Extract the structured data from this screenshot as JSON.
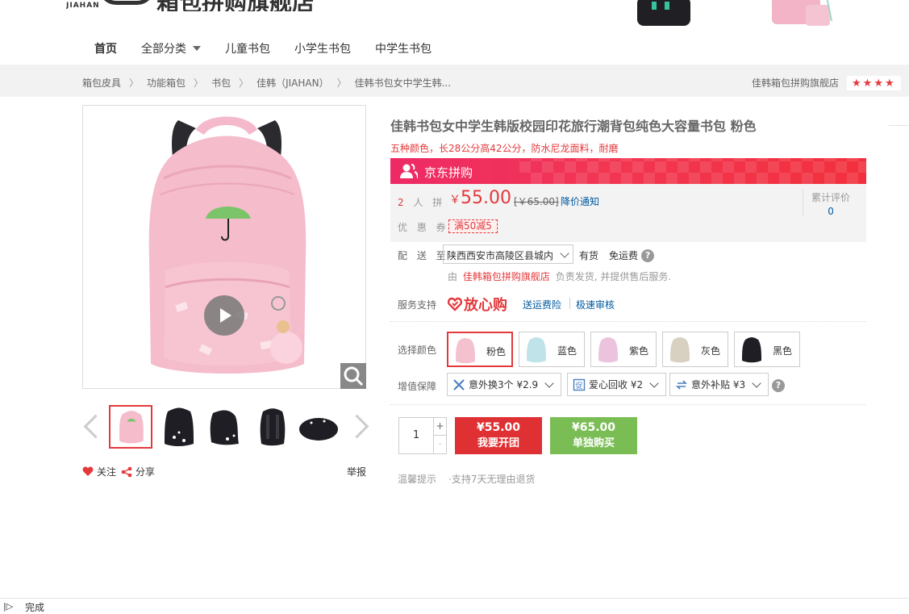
{
  "header": {
    "logo_en": "JIAHAN",
    "logo_cn": "箱包拼购旗舰店"
  },
  "nav": {
    "items": [
      {
        "label": "首页"
      },
      {
        "label": "全部分类"
      },
      {
        "label": "儿童书包"
      },
      {
        "label": "小学生书包"
      },
      {
        "label": "中学生书包"
      }
    ]
  },
  "breadcrumb": {
    "items": [
      "箱包皮具",
      "功能箱包",
      "书包",
      "佳韩（JIAHAN）",
      "佳韩书包女中学生韩..."
    ],
    "separator": "〉",
    "shop": "佳韩箱包拼购旗舰店",
    "stars": [
      "★",
      "★",
      "★",
      "★"
    ]
  },
  "product": {
    "title": "佳韩书包女中学生韩版校园印花旅行潮背包纯色大容量书包 粉色",
    "subtitle": "五种颜色，长28公分高42公分，防水尼龙面料，耐磨",
    "banner_label": "京东拼购",
    "people_count": "2",
    "people_label": "人 拼",
    "price_symbol": "￥",
    "price": "55.00",
    "orig_price": "[￥65.00]",
    "notify": "降价通知",
    "review_label": "累计评价",
    "review_count": "0",
    "coupon_label": "优 惠 券",
    "coupon": "满50减5"
  },
  "delivery": {
    "label": "配 送 至",
    "address": "陕西西安市高陵区县城内",
    "stock": "有货",
    "free": "免运费",
    "ship_prefix": "由",
    "ship_shop": "佳韩箱包拼购旗舰店",
    "ship_suffix": "负责发货, 并提供售后服务."
  },
  "service": {
    "label": "服务支持",
    "badge": "放心购",
    "link1": "送运费险",
    "link2": "极速审核"
  },
  "colors": {
    "label": "选择颜色",
    "options": [
      {
        "name": "粉色",
        "color": "#f4c1cf"
      },
      {
        "name": "蓝色",
        "color": "#bfe3e8"
      },
      {
        "name": "紫色",
        "color": "#ebc3dc"
      },
      {
        "name": "灰色",
        "color": "#d8d0c0"
      },
      {
        "name": "黑色",
        "color": "#1e1e24"
      }
    ]
  },
  "addons": {
    "label": "增值保障",
    "items": [
      {
        "label": "意外换3个 ¥2.9"
      },
      {
        "label": "爱心回收 ¥2"
      },
      {
        "label": "意外补贴 ¥3"
      }
    ]
  },
  "buy": {
    "qty": "1",
    "plus": "+",
    "minus": "-",
    "group_price": "¥55.00",
    "group_label": "我要开团",
    "solo_price": "¥65.00",
    "solo_label": "单独购买"
  },
  "tips": {
    "label": "温馨提示",
    "text": "·支持7天无理由退货"
  },
  "actions": {
    "follow": "关注",
    "share": "分享",
    "report": "举报"
  },
  "status": {
    "icon": "|▷",
    "text": "完成"
  },
  "accent": {
    "red": "#e4393c",
    "green": "#7abd54",
    "link": "#005aa0"
  }
}
